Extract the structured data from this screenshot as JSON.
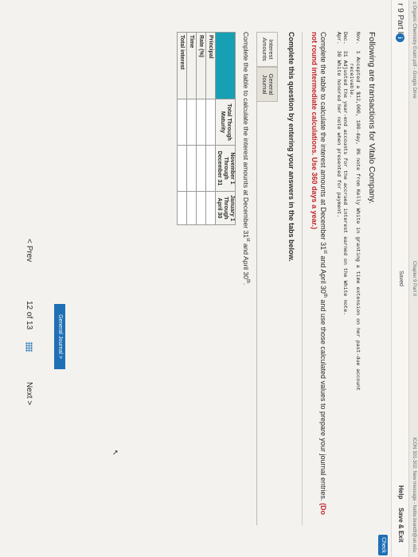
{
  "browser": {
    "tab_title": "s Organic Chemistry Exam.pdf - Google Drive",
    "chapter": "Chapter 9 Part II",
    "right_text": "ICON 301-302: New message - hattie.brandtl@un.edu"
  },
  "header": {
    "part_label": "r 9 Part II",
    "info_icon": "i",
    "saved": "Saved",
    "help": "Help",
    "save_exit": "Save & Exit",
    "check": "Check"
  },
  "question": {
    "intro": "Following are transactions for Vitalo Company.",
    "transactions": [
      "Nov.  1 Accepted a $12,000, 180-day, 8% note from Kelly White in granting a time extension on her past-due account",
      "          receivable.",
      "Dec.  31 Adjusted the year-end accounts for the accrued interest earned on the White note.",
      "Apr.  30 White honored her note when presented for payment."
    ],
    "instruction_a": "Complete the table to calculate the interest amounts at December 31",
    "instruction_sup1": "st",
    "instruction_b": " and April 30",
    "instruction_sup2": "th",
    "instruction_c": " and use those calculated values to prepare your journal entries. ",
    "instruction_red": "(Do not round intermediate calculations. Use 360 days a year.)",
    "subq": "Complete this question by entering your answers in the tabs below."
  },
  "tabs": [
    {
      "line1": "Interest",
      "line2": "Amounts"
    },
    {
      "line1": "General",
      "line2": "Journal"
    }
  ],
  "table": {
    "instruction_a": "Complete the table to calculate the interest amounts at December 31",
    "instruction_sup1": "st",
    "instruction_b": " and April 30",
    "instruction_sup2": "th",
    "instruction_c": ".",
    "columns": [
      {
        "l1": "Total Through",
        "l2": "Maturity"
      },
      {
        "l1": "November 1",
        "l2": "Through",
        "l3": "December 31"
      },
      {
        "l1": "January 1",
        "l2": "Through",
        "l3": "April 30"
      }
    ],
    "rows": [
      "Principal",
      "Rate (%)",
      "Time",
      "Total interest"
    ]
  },
  "nav": {
    "general_journal_btn": "General Journal  >",
    "prev": "<  Prev",
    "page": "12 of 13",
    "next": "Next  >"
  },
  "colors": {
    "accent": "#1f6fb5",
    "table_corner": "#17a0b4",
    "warning_red": "#c0262b"
  }
}
